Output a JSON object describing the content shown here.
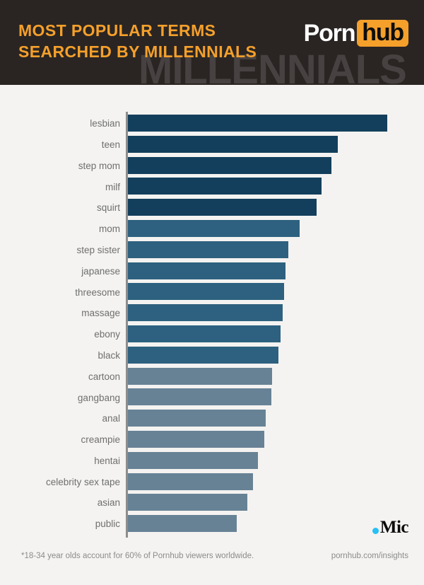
{
  "header": {
    "title_line1": "MOST POPULAR TERMS",
    "title_line2": "SEARCHED BY MILLENNIALS",
    "watermark": "MILLENNIALS",
    "logo_part1": "Porn",
    "logo_part2": "hub",
    "bg_color": "#2a2523",
    "accent_color": "#f5a02b",
    "watermark_color": "#474241"
  },
  "footer": {
    "note": "*18-34 year olds account for 60% of Pornhub viewers worldwide.",
    "url": "pornhub.com/insights",
    "mic_dot": "●",
    "mic_text": "Mic",
    "mic_dot_color": "#27c0f4"
  },
  "chart_data": {
    "type": "bar",
    "orientation": "horizontal",
    "title": "MOST POPULAR TERMS SEARCHED BY MILLENNIALS",
    "xlabel": "",
    "ylabel": "",
    "grid": false,
    "legend": null,
    "axis_labels_shown": false,
    "value_unit": "relative search volume (bar length, px)",
    "categories": [
      "lesbian",
      "teen",
      "step mom",
      "milf",
      "squirt",
      "mom",
      "step sister",
      "japanese",
      "threesome",
      "massage",
      "ebony",
      "black",
      "cartoon",
      "gangbang",
      "anal",
      "creampie",
      "hentai",
      "celebrity sex tape",
      "asian",
      "public"
    ],
    "values": [
      367,
      297,
      288,
      274,
      267,
      243,
      227,
      223,
      221,
      219,
      216,
      213,
      204,
      203,
      195,
      193,
      184,
      177,
      169,
      154
    ],
    "xlim": [
      0,
      380
    ],
    "colors": [
      "#133f5c",
      "#133f5c",
      "#133f5c",
      "#133f5c",
      "#133f5c",
      "#2d617f",
      "#2d617f",
      "#2d617f",
      "#2d617f",
      "#2d617f",
      "#2d617f",
      "#2d617f",
      "#678295",
      "#678295",
      "#678295",
      "#678295",
      "#678295",
      "#678295",
      "#678295",
      "#678295"
    ]
  }
}
